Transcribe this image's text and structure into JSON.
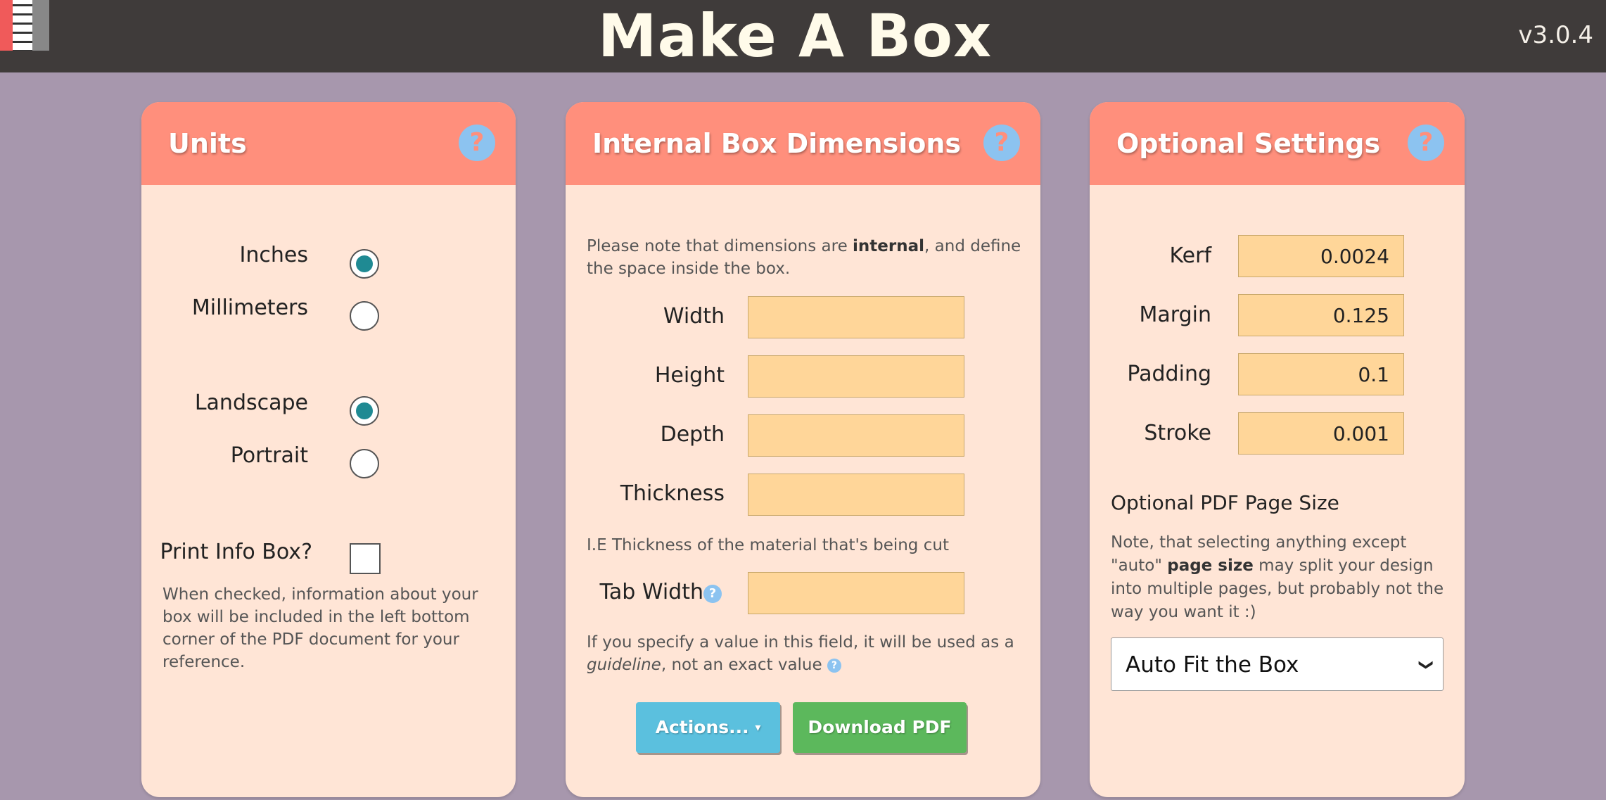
{
  "header": {
    "title": "Make A Box",
    "version": "v3.0.4"
  },
  "units": {
    "title": "Units",
    "help": "?",
    "inches": "Inches",
    "millimeters": "Millimeters",
    "landscape": "Landscape",
    "portrait": "Portrait",
    "print_info": "Print Info Box?",
    "print_info_note": "When checked, information about your box will be included in the left bottom corner of the PDF document for your reference."
  },
  "dimensions": {
    "title": "Internal Box Dimensions",
    "help": "?",
    "note_pre": "Please note that dimensions are ",
    "note_bold": "internal",
    "note_post": ", and define the space inside the box.",
    "width": "Width",
    "height": "Height",
    "depth": "Depth",
    "thickness": "Thickness",
    "thickness_note": "I.E Thickness of the material that's being cut",
    "tab_width": "Tab Width",
    "tab_help": "?",
    "tab_note_pre": "If you specify a value in this field, it will be used as a ",
    "tab_note_em": "guideline",
    "tab_note_post": ", not an exact value",
    "tab_note_help": "?",
    "actions": "Actions...",
    "download": "Download PDF"
  },
  "optional": {
    "title": "Optional Settings",
    "help": "?",
    "kerf": {
      "label": "Kerf",
      "value": "0.0024"
    },
    "margin": {
      "label": "Margin",
      "value": "0.125"
    },
    "padding": {
      "label": "Padding",
      "value": "0.1"
    },
    "stroke": {
      "label": "Stroke",
      "value": "0.001"
    },
    "pdf_heading": "Optional PDF Page Size",
    "pdf_note_pre": "Note, that selecting anything except \"auto\" ",
    "pdf_note_bold": "page size",
    "pdf_note_post": " may split your design into multiple pages, but probably not the way you want it :)",
    "page_size_selected": "Auto Fit the Box"
  },
  "colors": {
    "accent": "#ff8f7c",
    "card": "#ffe5d6",
    "field": "#ffd699",
    "radio": "#1f8a93"
  }
}
